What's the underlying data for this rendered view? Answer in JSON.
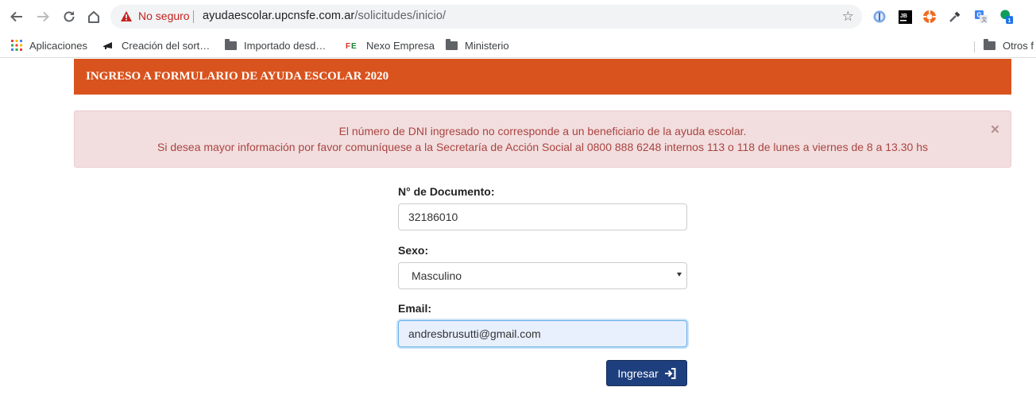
{
  "browser": {
    "security_label": "No seguro",
    "url_host": "ayudaescolar.upcnsfe.com.ar",
    "url_path": "/solicitudes/inicio/",
    "extension_badge": "1"
  },
  "bookmarks": [
    {
      "label": "Aplicaciones",
      "icon": "apps-grid-icon"
    },
    {
      "label": "Creación del sort…",
      "icon": "megaphone-icon"
    },
    {
      "label": "Importado desd…",
      "icon": "folder-icon"
    },
    {
      "label": "Nexo Empresa",
      "icon": "fe-logo-icon"
    },
    {
      "label": "Ministerio",
      "icon": "folder-icon"
    },
    {
      "label": "Otros f",
      "icon": "folder-icon"
    }
  ],
  "page": {
    "banner_title": "INGRESO A FORMULARIO DE AYUDA ESCOLAR 2020",
    "alert": {
      "line1": "El número de DNI ingresado no corresponde a un beneficiario de la ayuda escolar.",
      "line2": "Si desea mayor información por favor comuníquese a la Secretaría de Acción Social al 0800 888 6248 internos 113 o 118 de lunes a viernes de 8 a 13.30 hs",
      "close_glyph": "×"
    },
    "form": {
      "dni_label": "N° de Documento:",
      "dni_value": "32186010",
      "sex_label": "Sexo:",
      "sex_value": "Masculino",
      "email_label": "Email:",
      "email_value": "andresbrusutti@gmail.com",
      "submit_label": "Ingresar"
    }
  },
  "colors": {
    "banner": "#d9531e",
    "alert_bg": "#f2dede",
    "alert_text": "#a94442",
    "button": "#1e3f7d"
  }
}
